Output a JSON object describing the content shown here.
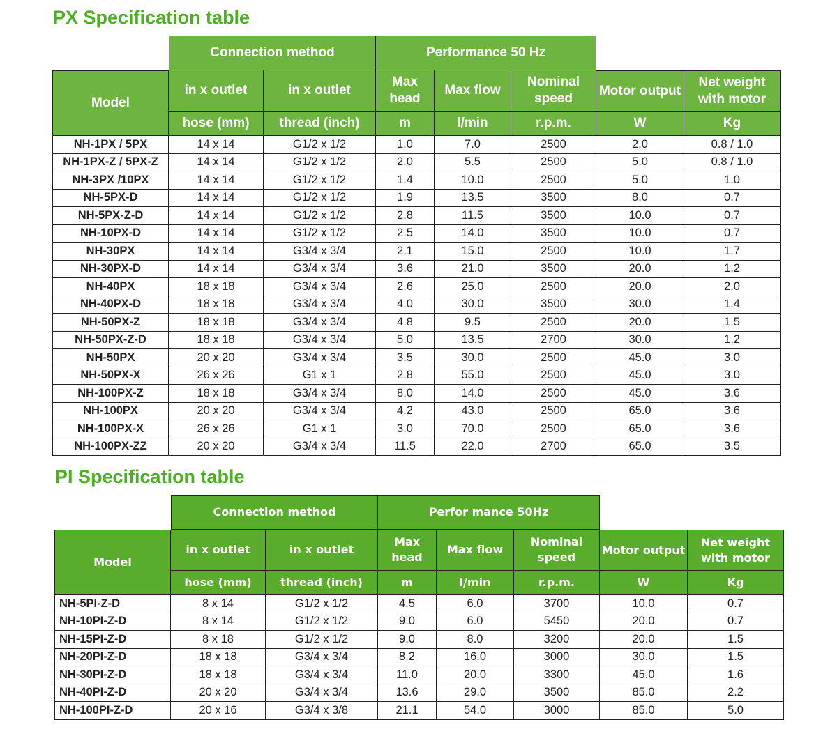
{
  "px": {
    "title": "PX Specification table",
    "group_headers": {
      "connection": "Connection method",
      "performance": "Performance 50 Hz"
    },
    "columns": [
      {
        "name": "Model",
        "unit": ""
      },
      {
        "name": "in x outlet",
        "unit": "hose  (mm)"
      },
      {
        "name": "in x outlet",
        "unit": "thread (inch)"
      },
      {
        "name": "Max head",
        "unit": "m"
      },
      {
        "name": "Max flow",
        "unit": "l/min"
      },
      {
        "name": "Nominal speed",
        "unit": "r.p.m."
      },
      {
        "name": "Motor output",
        "unit": "W"
      },
      {
        "name": "Net weight with motor",
        "unit": "Kg"
      }
    ],
    "rows": [
      [
        "NH-1PX / 5PX",
        "14 x 14",
        "G1/2 x 1/2",
        "1.0",
        "7.0",
        "2500",
        "2.0",
        "0.8 / 1.0"
      ],
      [
        "NH-1PX-Z / 5PX-Z",
        "14 x 14",
        "G1/2 x 1/2",
        "2.0",
        "5.5",
        "2500",
        "5.0",
        "0.8 / 1.0"
      ],
      [
        "NH-3PX /10PX",
        "14 x 14",
        "G1/2 x 1/2",
        "1.4",
        "10.0",
        "2500",
        "5.0",
        "1.0"
      ],
      [
        "NH-5PX-D",
        "14 x 14",
        "G1/2 x 1/2",
        "1.9",
        "13.5",
        "3500",
        "8.0",
        "0.7"
      ],
      [
        "NH-5PX-Z-D",
        "14 x 14",
        "G1/2 x 1/2",
        "2.8",
        "11.5",
        "3500",
        "10.0",
        "0.7"
      ],
      [
        "NH-10PX-D",
        "14 x 14",
        "G1/2 x 1/2",
        "2.5",
        "14.0",
        "3500",
        "10.0",
        "0.7"
      ],
      [
        "NH-30PX",
        "14 x 14",
        "G3/4 x 3/4",
        "2.1",
        "15.0",
        "2500",
        "10.0",
        "1.7"
      ],
      [
        "NH-30PX-D",
        "14 x 14",
        "G3/4 x 3/4",
        "3.6",
        "21.0",
        "3500",
        "20.0",
        "1.2"
      ],
      [
        "NH-40PX",
        "18 x 18",
        "G3/4 x 3/4",
        "2.6",
        "25.0",
        "2500",
        "20.0",
        "2.0"
      ],
      [
        "NH-40PX-D",
        "18 x 18",
        "G3/4 x 3/4",
        "4.0",
        "30.0",
        "3500",
        "30.0",
        "1.4"
      ],
      [
        "NH-50PX-Z",
        "18 x 18",
        "G3/4 x 3/4",
        "4.8",
        "9.5",
        "2500",
        "20.0",
        "1.5"
      ],
      [
        "NH-50PX-Z-D",
        "18 x 18",
        "G3/4 x 3/4",
        "5.0",
        "13.5",
        "2700",
        "30.0",
        "1.2"
      ],
      [
        "NH-50PX",
        "20 x 20",
        "G3/4 x 3/4",
        "3.5",
        "30.0",
        "2500",
        "45.0",
        "3.0"
      ],
      [
        "NH-50PX-X",
        "26 x 26",
        "G1 x 1",
        "2.8",
        "55.0",
        "2500",
        "45.0",
        "3.0"
      ],
      [
        "NH-100PX-Z",
        "18 x 18",
        "G3/4 x 3/4",
        "8.0",
        "14.0",
        "2500",
        "45.0",
        "3.6"
      ],
      [
        "NH-100PX",
        "20 x 20",
        "G3/4 x 3/4",
        "4.2",
        "43.0",
        "2500",
        "65.0",
        "3.6"
      ],
      [
        "NH-100PX-X",
        "26 x 26",
        "G1 x 1",
        "3.0",
        "70.0",
        "2500",
        "65.0",
        "3.6"
      ],
      [
        "NH-100PX-ZZ",
        "20 x 20",
        "G3/4 x 3/4",
        "11.5",
        "22.0",
        "2700",
        "65.0",
        "3.5"
      ]
    ]
  },
  "pi": {
    "title": "PI Specification table",
    "group_headers": {
      "connection": "Connection method",
      "performance": "Perfor mance 50Hz"
    },
    "columns": [
      {
        "name": "Model",
        "unit": ""
      },
      {
        "name": "in x outlet",
        "unit": "hose  (mm)"
      },
      {
        "name": "in x outlet",
        "unit": "thread (inch)"
      },
      {
        "name": "Max head",
        "unit": "m"
      },
      {
        "name": "Max flow",
        "unit": "l/min"
      },
      {
        "name": "Nominal speed",
        "unit": "r.p.m."
      },
      {
        "name": "Motor output",
        "unit": "W"
      },
      {
        "name": "Net weight with motor",
        "unit": "Kg"
      }
    ],
    "rows": [
      [
        "NH-5PI-Z-D",
        "8 x 14",
        "G1/2 x 1/2",
        "4.5",
        "6.0",
        "3700",
        "10.0",
        "0.7"
      ],
      [
        "NH-10PI-Z-D",
        "8 x 14",
        "G1/2 x 1/2",
        "9.0",
        "6.0",
        "5450",
        "20.0",
        "0.7"
      ],
      [
        "NH-15PI-Z-D",
        "8 x 18",
        "G1/2 x 1/2",
        "9.0",
        "8.0",
        "3200",
        "20.0",
        "1.5"
      ],
      [
        "NH-20PI-Z-D",
        "18 x 18",
        "G3/4 x 3/4",
        "8.2",
        "16.0",
        "3000",
        "30.0",
        "1.5"
      ],
      [
        "NH-30PI-Z-D",
        "18 x 18",
        "G3/4 x 3/4",
        "11.0",
        "20.0",
        "3300",
        "45.0",
        "1.6"
      ],
      [
        "NH-40PI-Z-D",
        "20 x 20",
        "G3/4 x 3/4",
        "13.6",
        "29.0",
        "3500",
        "85.0",
        "2.2"
      ],
      [
        "NH-100PI-Z-D",
        "20 x 16",
        "G3/4 x 3/8",
        "21.1",
        "54.0",
        "3000",
        "85.0",
        "5.0"
      ]
    ]
  }
}
